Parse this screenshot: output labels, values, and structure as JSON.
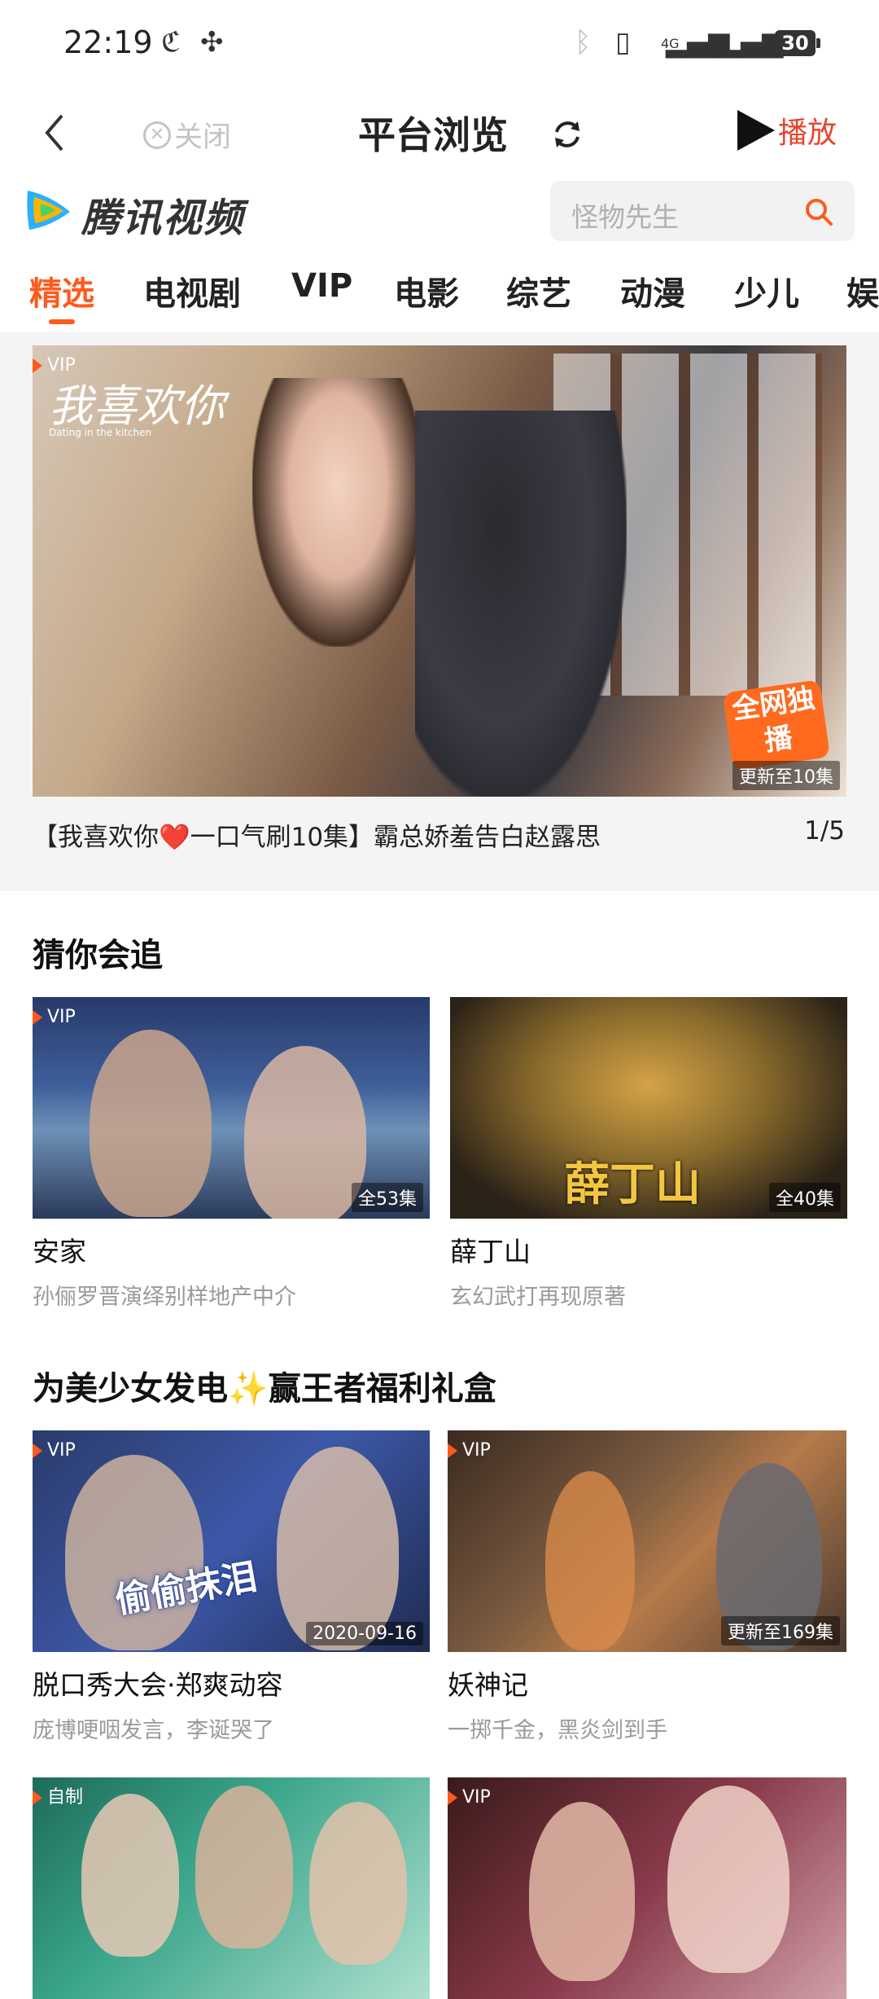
{
  "status_bar": {
    "time": "22:19",
    "battery": "30",
    "network": "4G"
  },
  "topbar": {
    "close_label": "关闭",
    "title": "平台浏览",
    "play_label": "播放"
  },
  "header": {
    "logo_text": "腾讯视频",
    "search_placeholder": "怪物先生"
  },
  "tabs": [
    {
      "label": "精选",
      "active": true
    },
    {
      "label": "电视剧"
    },
    {
      "label": "VIP"
    },
    {
      "label": "电影"
    },
    {
      "label": "综艺"
    },
    {
      "label": "动漫"
    },
    {
      "label": "少儿"
    },
    {
      "label": "娱"
    }
  ],
  "hero": {
    "tag": "VIP",
    "overlay_title": "我喜欢你",
    "overlay_sub": "Dating in the kitchen",
    "exclusive_badge": "全网独播",
    "episode_tag": "更新至10集",
    "caption": "【我喜欢你❤️一口气刷10集】霸总娇羞告白赵露思",
    "pager": "1/5"
  },
  "sections": [
    {
      "title": "猜你会追",
      "cards": [
        {
          "tag": "VIP",
          "count": "全53集",
          "title": "安家",
          "subtitle": "孙俪罗晋演绎别样地产中介"
        },
        {
          "tag": "",
          "count": "全40集",
          "title": "薛丁山",
          "subtitle": "玄幻武打再现原著",
          "overlay": "薛丁山"
        }
      ]
    },
    {
      "title": "为美少女发电✨赢王者福利礼盒",
      "cards": [
        {
          "tag": "VIP",
          "count": "2020-09-16",
          "title": "脱口秀大会·郑爽动容",
          "subtitle": "庞博哽咽发言，李诞哭了",
          "overlay": "偷偷抹泪"
        },
        {
          "tag": "VIP",
          "count": "更新至169集",
          "title": "妖神记",
          "subtitle": "一掷千金，黑炎剑到手"
        }
      ]
    },
    {
      "title": "",
      "cards": [
        {
          "tag": "自制"
        },
        {
          "tag": "VIP"
        }
      ]
    }
  ],
  "colors": {
    "accent": "#ff5a1e",
    "play_red": "#e8442d",
    "subtitle_gray": "#9a9a9a"
  }
}
